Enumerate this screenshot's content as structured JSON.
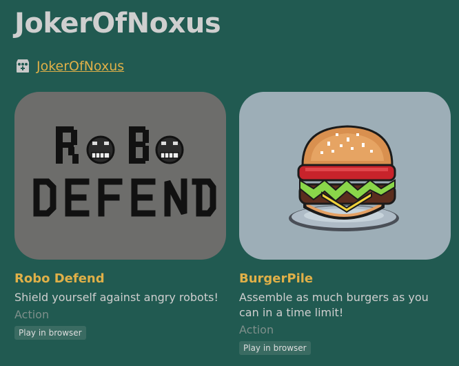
{
  "page": {
    "title": "JokerOfNoxus",
    "profile_link": "JokerOfNoxus",
    "profile_icon": "itchio-storefront-icon"
  },
  "colors": {
    "background": "#215a51",
    "accent": "#e0b048",
    "badge_bg": "#3a6b62"
  },
  "games": [
    {
      "title": "Robo Defend",
      "description": "Shield yourself against angry robots!",
      "genre": "Action",
      "platform": "Play in browser",
      "thumb_text_top": "RoBo",
      "thumb_text_bottom": "DEFEND"
    },
    {
      "title": "BurgerPile",
      "description": "Assemble as much burgers as you can in a time limit!",
      "genre": "Action",
      "platform": "Play in browser"
    }
  ]
}
